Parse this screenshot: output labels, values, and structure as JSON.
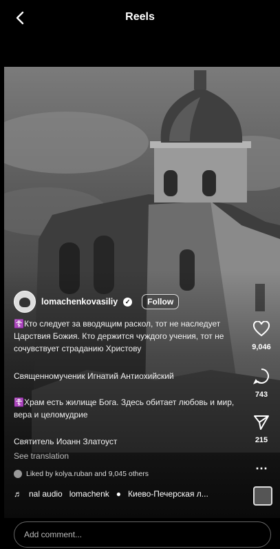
{
  "header": {
    "title": "Reels"
  },
  "post": {
    "username": "lomachenkovasiliy",
    "follow_label": "Follow",
    "captions": [
      "☦️Кто следует за вводящим раскол, тот не наследует Царствия Божия. Кто держится чуждого учения, тот не сочувствует страданию Христову",
      "Священномученик Игнатий Антиохийский",
      "☦️Храм есть жилище Бога. Здесь обитает любовь и мир, вера и целомудрие",
      "Святитель Иоанн Златоуст"
    ],
    "see_translation": "See translation",
    "liked_by": "Liked by kolya.ruban and 9,045 others",
    "audio": "nal audio",
    "audio_user": "lomachenk",
    "location": "Киево-Печерская л...",
    "comment_placeholder": "Add comment..."
  },
  "actions": {
    "likes": "9,046",
    "comments": "743",
    "shares": "215"
  }
}
